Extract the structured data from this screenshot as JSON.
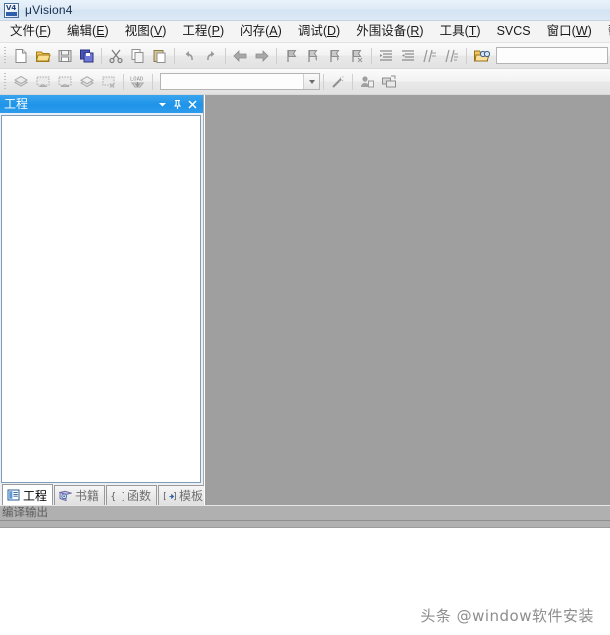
{
  "window": {
    "title": "μVision4",
    "app_icon": "uvision4-icon",
    "icon_text": "V4"
  },
  "menubar": {
    "items": [
      {
        "label": "文件",
        "mnemonic": "F"
      },
      {
        "label": "编辑",
        "mnemonic": "E"
      },
      {
        "label": "视图",
        "mnemonic": "V"
      },
      {
        "label": "工程",
        "mnemonic": "P"
      },
      {
        "label": "闪存",
        "mnemonic": "A"
      },
      {
        "label": "调试",
        "mnemonic": "D"
      },
      {
        "label": "外围设备",
        "mnemonic": "R"
      },
      {
        "label": "工具",
        "mnemonic": "T"
      },
      {
        "label": "SVCS",
        "mnemonic": ""
      },
      {
        "label": "窗口",
        "mnemonic": "W"
      },
      {
        "label": "帮助",
        "mnemonic": "H"
      }
    ]
  },
  "toolbar_main": {
    "buttons": [
      "new-file-icon",
      "open-file-icon",
      "save-icon",
      "save-all-icon",
      "cut-icon",
      "copy-icon",
      "paste-icon",
      "undo-icon",
      "redo-icon",
      "navigate-back-icon",
      "navigate-forward-icon",
      "bookmark-toggle-icon",
      "bookmark-prev-icon",
      "bookmark-next-icon",
      "bookmark-clear-icon",
      "indent-icon",
      "outdent-icon",
      "comment-icon",
      "uncomment-icon",
      "find-in-files-icon"
    ],
    "search": {
      "value": "",
      "placeholder": ""
    }
  },
  "toolbar_build": {
    "buttons": [
      "translate-icon",
      "build-target-icon",
      "rebuild-all-icon",
      "batch-build-icon",
      "stop-build-icon",
      "download-icon"
    ],
    "target_combo": {
      "value": "",
      "placeholder": ""
    },
    "buttons_right": [
      "target-options-icon",
      "manage-components-icon",
      "multi-project-icon"
    ]
  },
  "project_panel": {
    "title": "工程",
    "menu_icon": "chevron-down-icon",
    "pin_icon": "pin-icon",
    "close_icon": "close-icon",
    "tree_items": [],
    "tabs": [
      {
        "label": "工程",
        "icon": "project-icon",
        "active": true
      },
      {
        "label": "书籍",
        "icon": "books-icon",
        "active": false
      },
      {
        "label": "函数",
        "icon": "functions-icon",
        "active": false
      },
      {
        "label": "模板",
        "icon": "templates-icon",
        "active": false
      }
    ]
  },
  "output_panel": {
    "title": "编译输出"
  },
  "watermark": {
    "text": "头条 @window软件安装"
  },
  "colors": {
    "titlebar": "#dfeaf6",
    "dock_title": "#1e93e8",
    "mdi_background": "#9f9f9f",
    "output_background": "#b0b0b0",
    "menubar": "#f4f4f4"
  }
}
